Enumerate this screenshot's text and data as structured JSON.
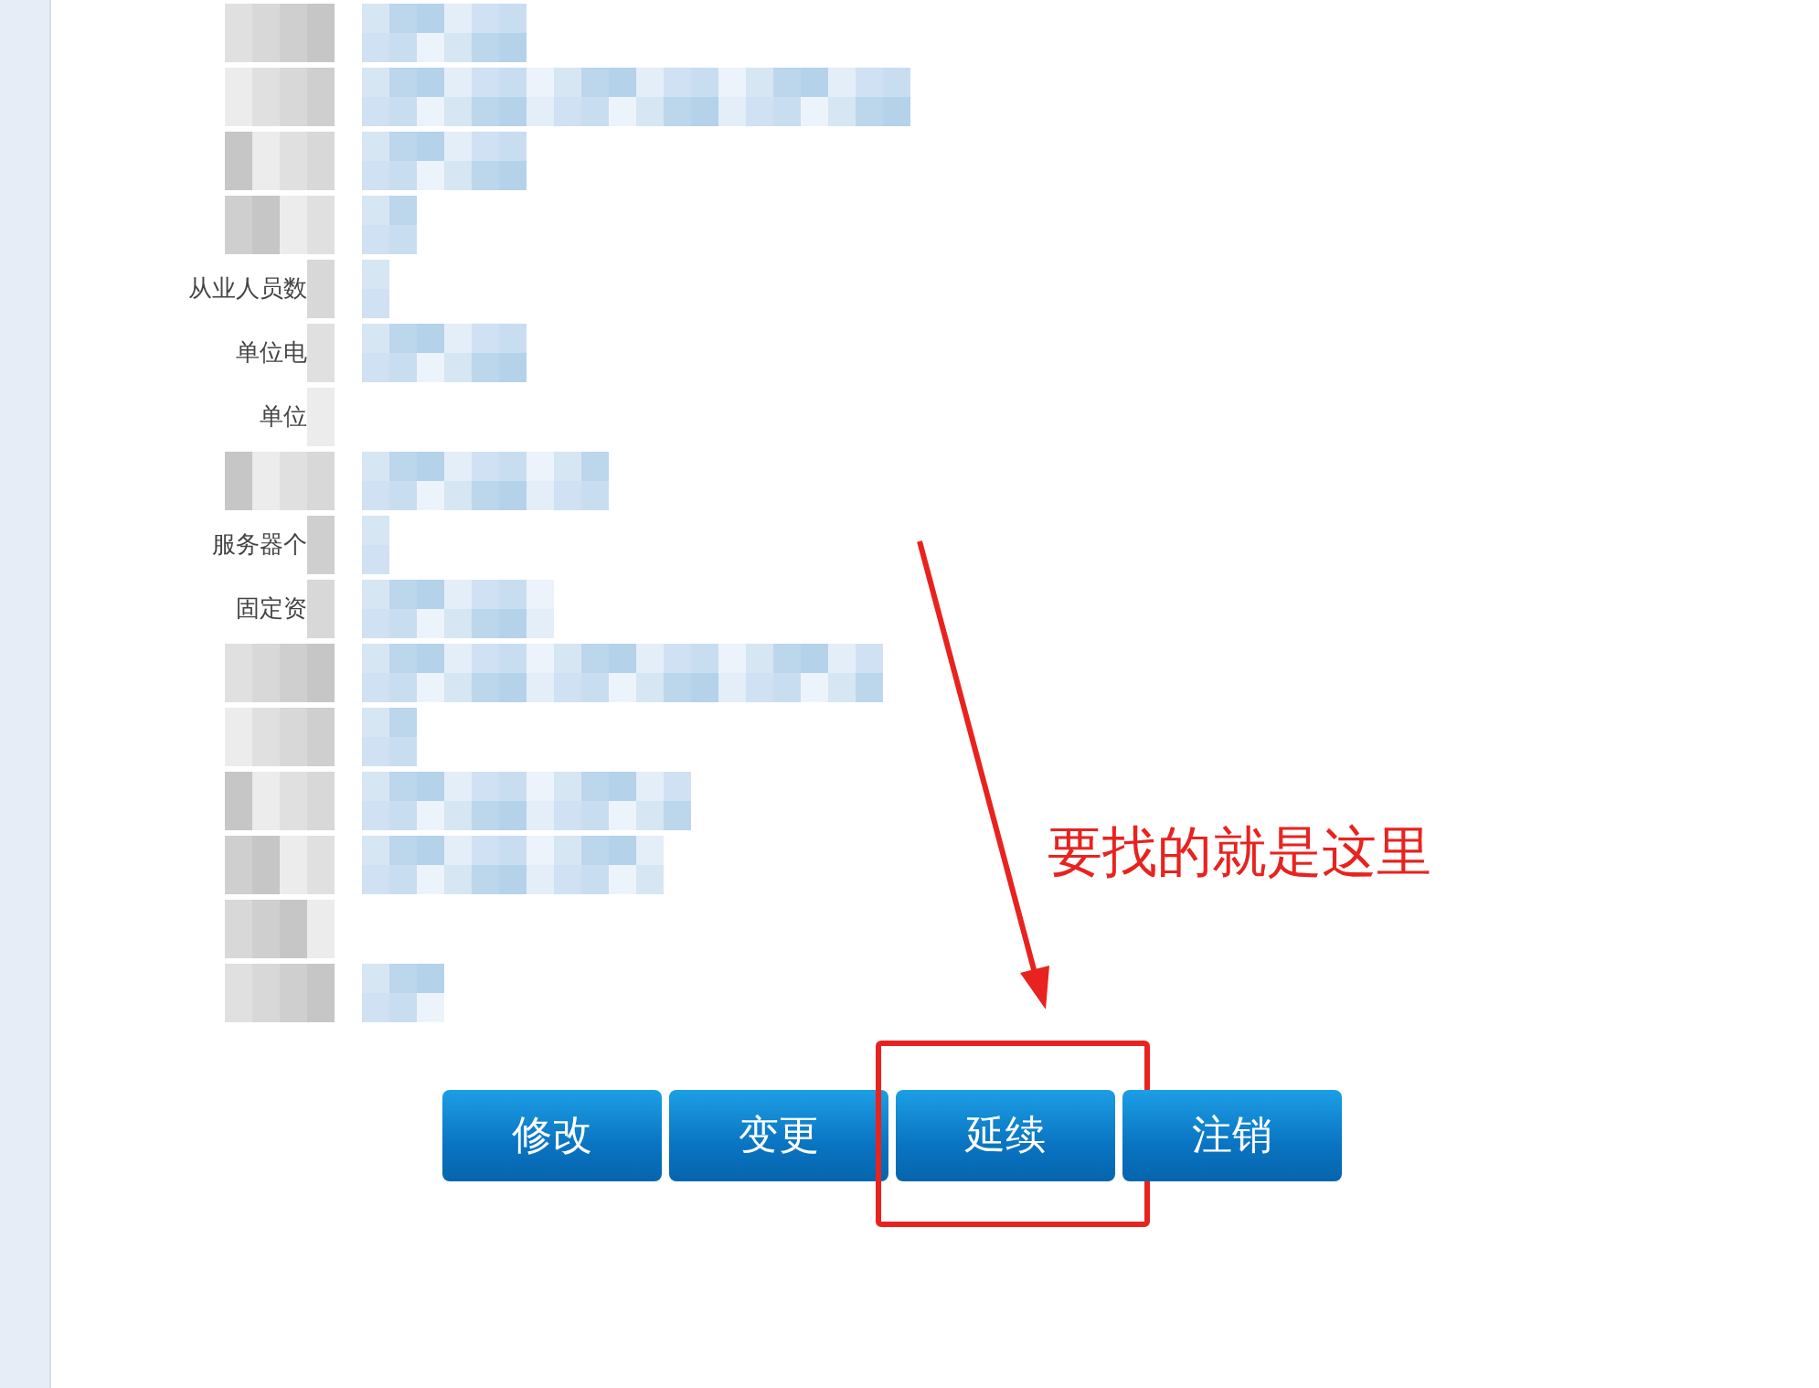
{
  "form_rows": [
    {
      "label_hidden": true
    },
    {
      "label_hidden": true
    },
    {
      "label_hidden": true
    },
    {
      "label_hidden": true
    },
    {
      "label": "从业人员数"
    },
    {
      "label": "单位电"
    },
    {
      "label": "单位"
    },
    {
      "label_hidden": true
    },
    {
      "label": "服务器个"
    },
    {
      "label": "固定资"
    },
    {
      "label_hidden": true
    },
    {
      "label_hidden": true
    },
    {
      "label_hidden": true
    },
    {
      "label_hidden": true
    },
    {
      "label_hidden": true
    },
    {
      "label_hidden": true
    }
  ],
  "buttons": [
    {
      "label": "修改",
      "highlighted": false
    },
    {
      "label": "变更",
      "highlighted": false
    },
    {
      "label": "延续",
      "highlighted": true
    },
    {
      "label": "注销",
      "highlighted": false
    }
  ],
  "annotation": {
    "note": "要找的就是这里"
  }
}
